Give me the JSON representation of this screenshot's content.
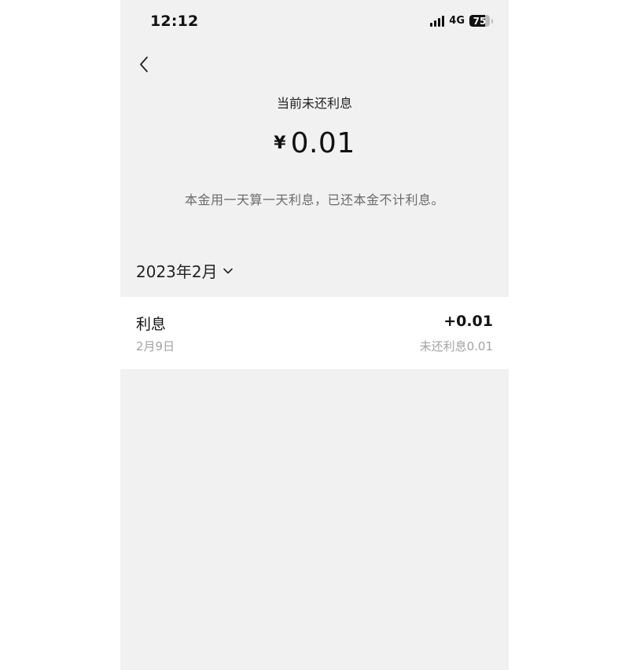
{
  "status_bar": {
    "time": "12:12",
    "network": "4G",
    "battery": "75",
    "battery_level_percent": 75
  },
  "header": {
    "back_icon": "chevron-left-icon"
  },
  "summary": {
    "label": "当前未还利息",
    "currency": "¥",
    "amount": "0.01",
    "note": "本金用一天算一天利息，已还本金不计利息。"
  },
  "filter": {
    "month": "2023年2月",
    "icon": "chevron-down-icon"
  },
  "records": [
    {
      "title": "利息",
      "date": "2月9日",
      "amount": "+0.01",
      "status": "未还利息0.01"
    }
  ],
  "colors": {
    "background": "#f1f1f1",
    "card": "#ffffff",
    "text_primary": "#111111",
    "text_secondary": "#a3a3a3"
  }
}
